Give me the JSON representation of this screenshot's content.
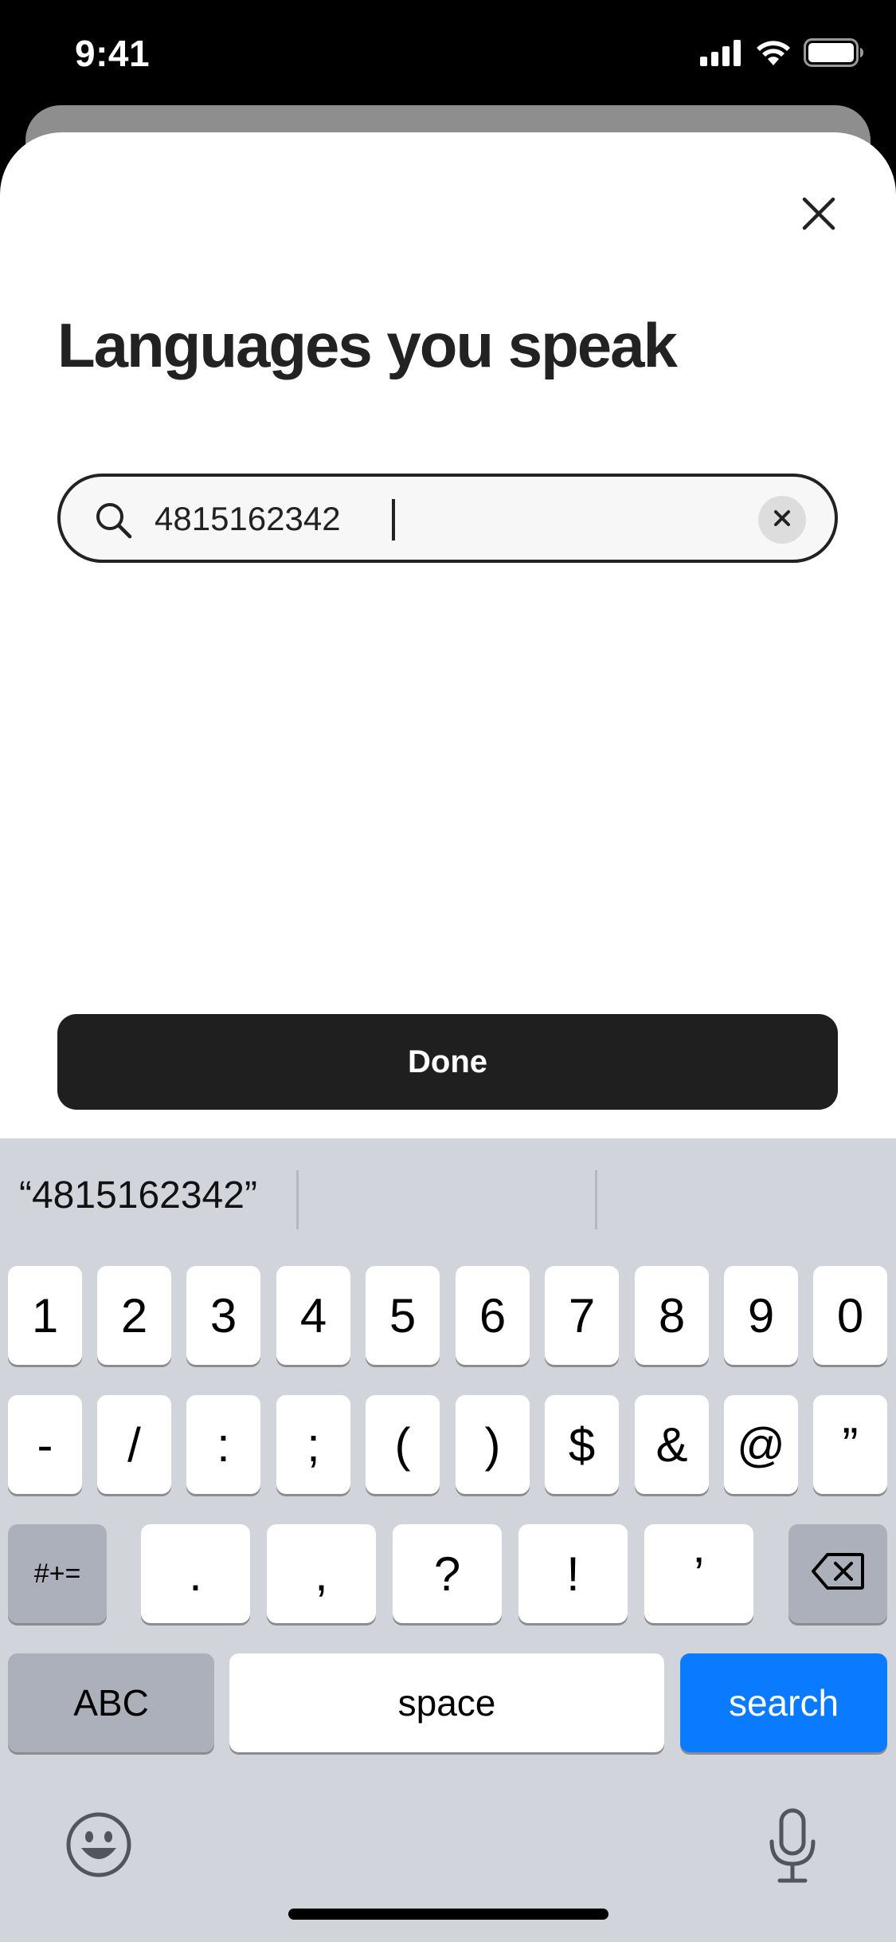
{
  "status_bar": {
    "time": "9:41",
    "icons": [
      "cellular-signal-icon",
      "wifi-icon",
      "battery-icon"
    ]
  },
  "sheet": {
    "title": "Languages you speak",
    "close_icon": "close-icon",
    "search": {
      "value": "4815162342",
      "placeholder": "",
      "icon": "search-icon",
      "clear_icon": "clear-icon"
    },
    "done_label": "Done"
  },
  "keyboard": {
    "suggestion": "“4815162342”",
    "row1": [
      "1",
      "2",
      "3",
      "4",
      "5",
      "6",
      "7",
      "8",
      "9",
      "0"
    ],
    "row2": [
      "-",
      "/",
      ":",
      ";",
      "(",
      ")",
      "$",
      "&",
      "@",
      "”"
    ],
    "row3": {
      "toggle": "#+=",
      "keys": [
        ".",
        ",",
        "?",
        "!",
        "’"
      ],
      "delete_icon": "backspace-icon"
    },
    "row4": {
      "abc": "ABC",
      "space": "space",
      "search": "search"
    },
    "bottom": {
      "emoji_icon": "emoji-icon",
      "mic_icon": "microphone-icon"
    }
  },
  "colors": {
    "accent": "#0a7aff",
    "keyboard_bg": "#d1d4db",
    "button_dark": "#1f1f1f"
  }
}
